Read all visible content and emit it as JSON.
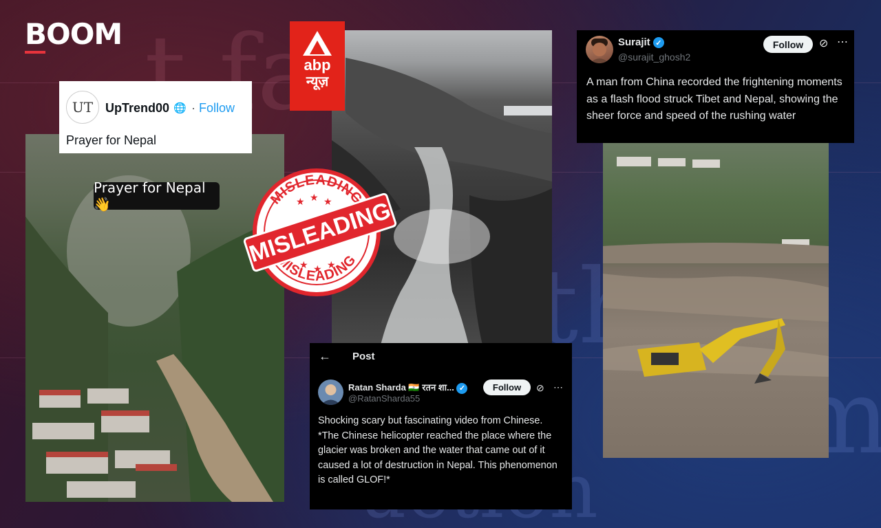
{
  "brand": {
    "boom_logo": "BOOM",
    "abp_logo_en": "abp",
    "abp_logo_hi": "न्यूज़",
    "accent": "#e2231a"
  },
  "background_words": [
    "t fa",
    "th",
    "me",
    "uction"
  ],
  "left_post": {
    "avatar_text": "UT",
    "username": "UpTrend00",
    "follow_label": "Follow",
    "body": "Prayer for Nepal",
    "video_caption": "Prayer for Nepal 👋"
  },
  "stamp": {
    "main": "MISLEADING",
    "top_arc": "MISLEADING",
    "bottom_arc": "MISLEADING",
    "color": "#e1262d"
  },
  "surajit_post": {
    "name": "Surajit",
    "handle": "@surajit_ghosh2",
    "follow_label": "Follow",
    "body": "A man from China recorded the frightening moments as a flash flood struck Tibet and Nepal, showing the sheer force and speed of the rushing water"
  },
  "ratan_post": {
    "header": "Post",
    "name": "Ratan Sharda 🇮🇳 रतन शा...",
    "handle": "@RatanSharda55",
    "follow_label": "Follow",
    "body": "Shocking scary but fascinating video from Chinese.\n*The Chinese helicopter reached the place where the glacier was broken and the water that came out of it caused a lot of destruction in Nepal.  This phenomenon is called GLOF!*"
  }
}
